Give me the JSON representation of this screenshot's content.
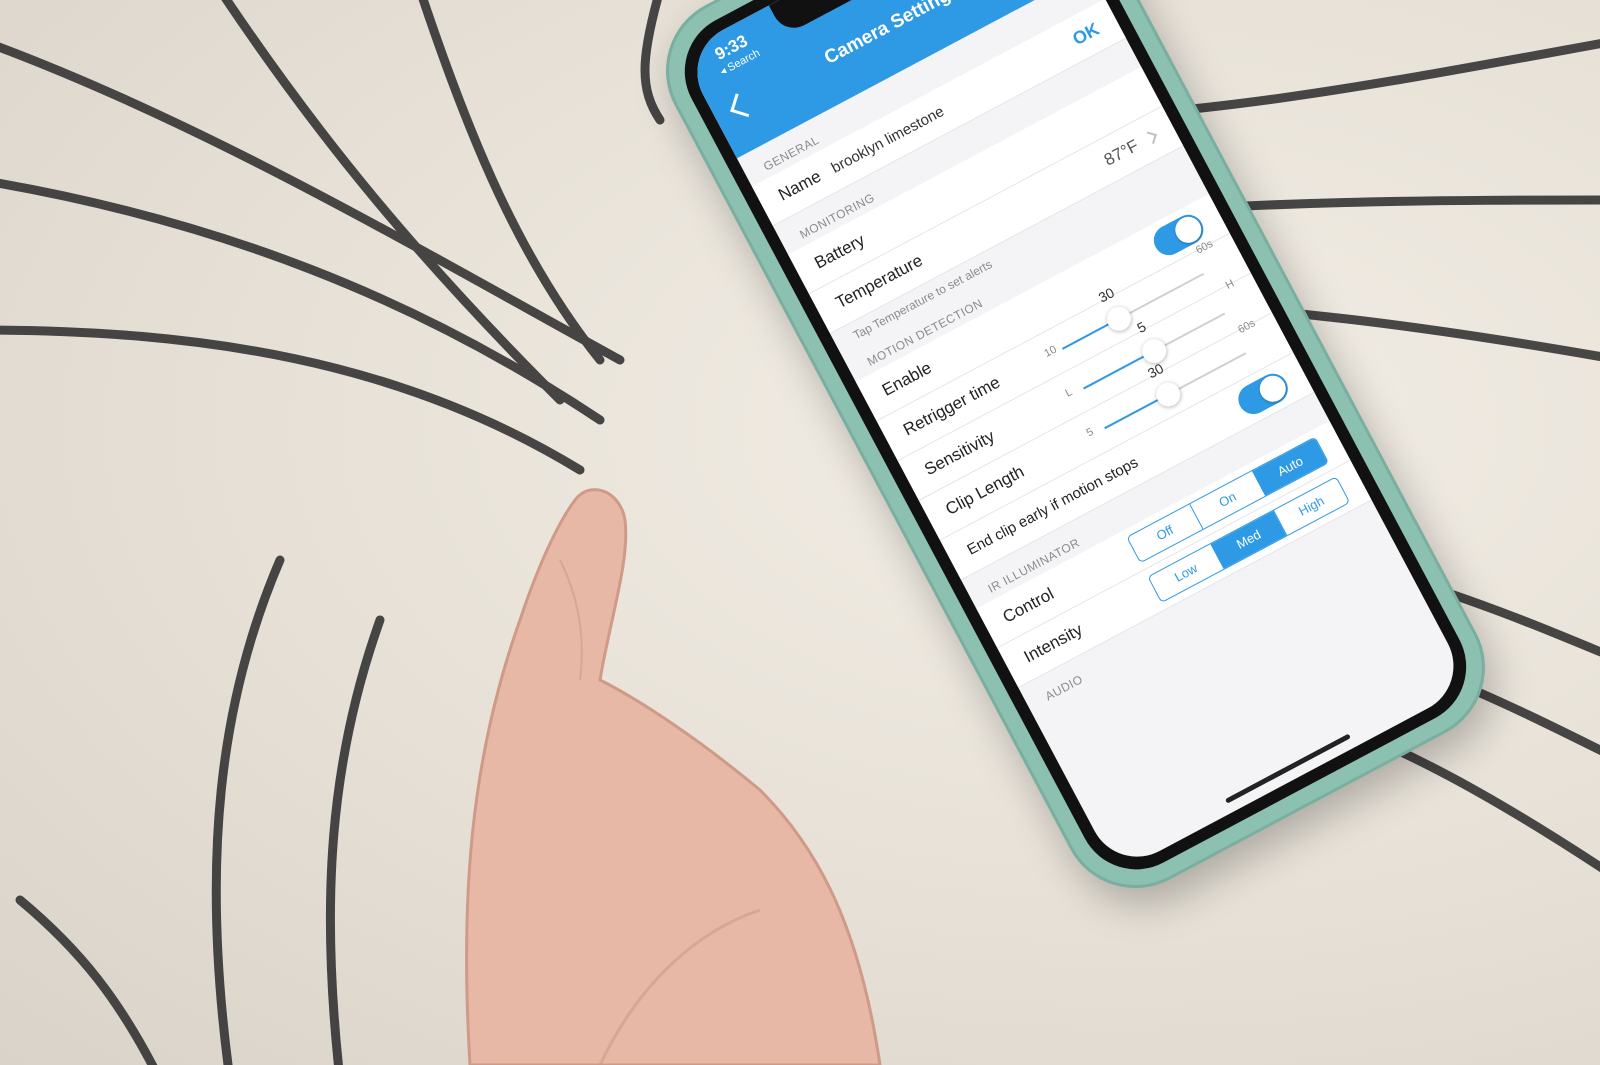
{
  "status": {
    "time": "9:33",
    "back_app": "◂ Search"
  },
  "nav": {
    "title": "Camera Settings"
  },
  "general": {
    "section": "GENERAL",
    "name_label": "Name",
    "name_value": "brooklyn limestone",
    "ok_label": "OK"
  },
  "monitoring": {
    "section": "MONITORING",
    "battery_label": "Battery",
    "temperature_label": "Temperature",
    "temperature_value": "87°F",
    "hint": "Tap Temperature to set alerts"
  },
  "motion": {
    "section": "MOTION DETECTION",
    "enable_label": "Enable",
    "enable_on": true,
    "retrigger_label": "Retrigger time",
    "retrigger": {
      "min": "10",
      "max": "60s",
      "value": "30",
      "fraction": 0.4
    },
    "sensitivity_label": "Sensitivity",
    "sensitivity": {
      "min": "L",
      "max": "H",
      "value": "5",
      "fraction": 0.5
    },
    "clip_label": "Clip Length",
    "clip": {
      "min": "5",
      "max": "60s",
      "value": "30",
      "fraction": 0.45
    },
    "endclip_label": "End clip early if motion stops",
    "endclip_on": true
  },
  "ir": {
    "section": "IR ILLUMINATOR",
    "control_label": "Control",
    "control_options": [
      "Off",
      "On",
      "Auto"
    ],
    "control_selected": "Auto",
    "intensity_label": "Intensity",
    "intensity_options": [
      "Low",
      "Med",
      "High"
    ],
    "intensity_selected": "Med"
  },
  "audio": {
    "section": "AUDIO"
  },
  "colors": {
    "accent": "#2e9ae6",
    "case": "#8cc0b0"
  }
}
